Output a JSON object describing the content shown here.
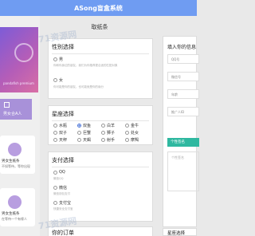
{
  "header": {
    "title": "ASong盲盒系统"
  },
  "page_title": "取纸条",
  "left": {
    "profile_sub": "pandafish premium",
    "tag_label": "男女合A人",
    "cards": [
      {
        "line1": "男女生纸条",
        "line2": "不如等待，等你出现"
      },
      {
        "line1": "男女生纸条",
        "line2": "在等待一个有缘人"
      }
    ]
  },
  "gender": {
    "title": "性别选择",
    "options": [
      {
        "label": "男",
        "note": "你和你身边的朋友，我们为你推荐更合适的匹配对象"
      },
      {
        "label": "女",
        "note": "你可能是你的朋友，也可能就是你的缘分"
      }
    ]
  },
  "zodiac": {
    "title": "星座选择",
    "items": [
      "水瓶",
      "双鱼",
      "白羊",
      "金牛",
      "双子",
      "巨蟹",
      "狮子",
      "处女",
      "天秤",
      "天蝎",
      "射手",
      "摩羯"
    ],
    "selected": "双鱼"
  },
  "payment": {
    "title": "支付选择",
    "options": [
      {
        "label": "QQ",
        "note": "微信QQ"
      },
      {
        "label": "微信",
        "note": "微信钱包支付"
      },
      {
        "label": "支付宝",
        "note": "快捷安全支付宝"
      }
    ]
  },
  "next_section": {
    "title": "你的订单"
  },
  "form": {
    "title": "填入你的信息",
    "fields": [
      {
        "placeholder": "QQ号"
      },
      {
        "placeholder": "微信号"
      },
      {
        "placeholder": "年龄"
      },
      {
        "placeholder": "推广人ID"
      }
    ],
    "confirm_label": "个性签名",
    "signature_placeholder": "个性签名"
  },
  "right_bottom": {
    "title": "星座选择"
  },
  "watermark": "71资源网"
}
